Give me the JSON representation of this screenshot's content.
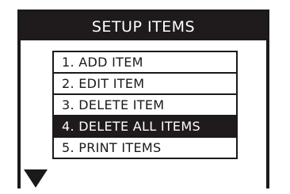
{
  "title": "SETUP ITEMS",
  "menu": {
    "items": [
      {
        "label": "1. ADD ITEM"
      },
      {
        "label": "2. EDIT ITEM"
      },
      {
        "label": "3. DELETE ITEM"
      },
      {
        "label": "4. DELETE ALL ITEMS"
      },
      {
        "label": "5. PRINT ITEMS"
      }
    ],
    "selected_index": 3
  },
  "icons": {
    "scroll": "scroll-down-arrow-icon"
  },
  "colors": {
    "highlight_bg": "#1f1b1c",
    "highlight_fg": "#ffffff",
    "border": "#1a1a1a"
  }
}
